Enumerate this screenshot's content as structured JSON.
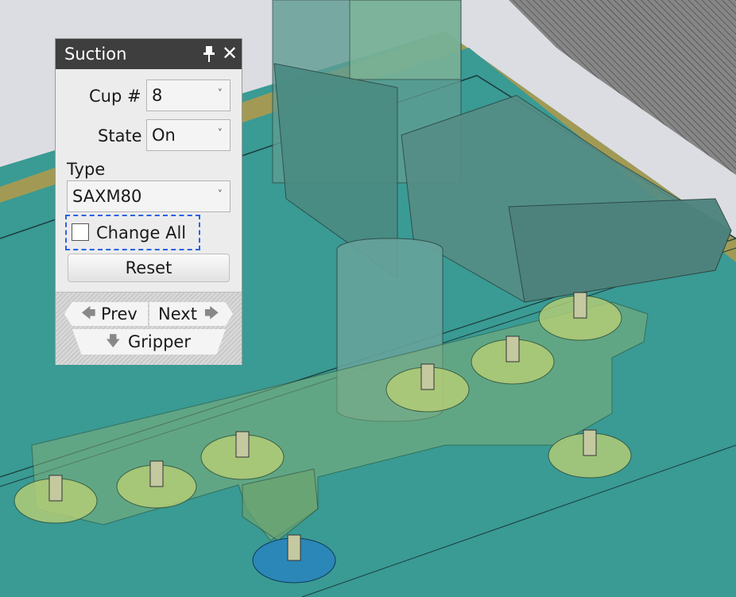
{
  "panel": {
    "title": "Suction",
    "pin_icon": "pin-icon",
    "close_icon": "close-icon",
    "cup_label": "Cup #",
    "cup_value": "8",
    "state_label": "State",
    "state_value": "On",
    "type_label": "Type",
    "type_value": "SAXM80",
    "change_all_label": "Change All",
    "change_all_checked": false,
    "reset_label": "Reset",
    "prev_label": "Prev",
    "next_label": "Next",
    "gripper_label": "Gripper",
    "prev_icon": "arrow-left-icon",
    "next_icon": "arrow-right-icon",
    "gripper_icon": "arrow-down-icon"
  },
  "colors": {
    "panel_title_bg": "#3e3e3e",
    "focus_border": "#2a62e2",
    "floor": "#3a9a94",
    "selected_cup": "#2a87b8"
  }
}
